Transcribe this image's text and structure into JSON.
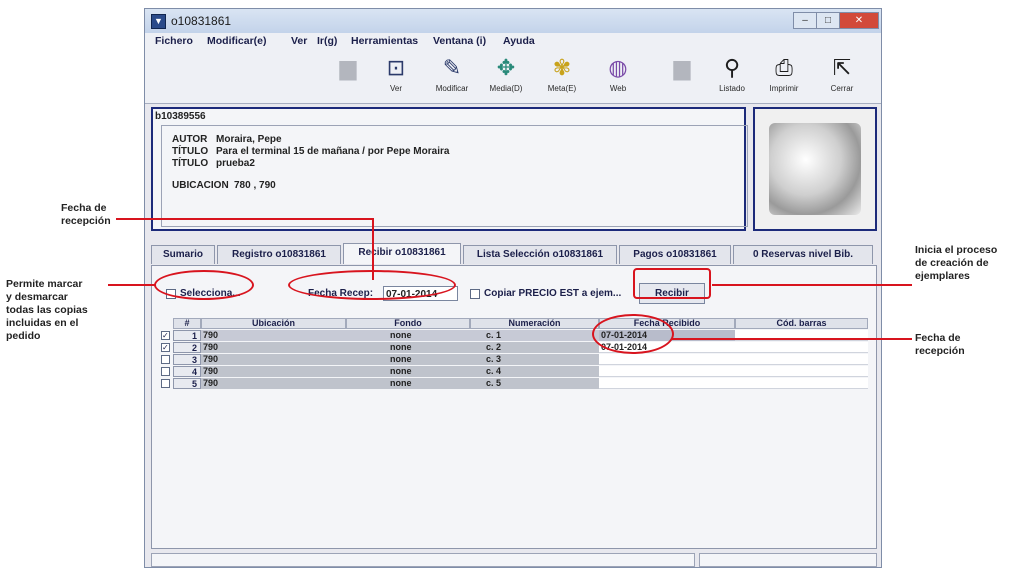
{
  "window": {
    "title": "o10831861"
  },
  "menu": [
    "Fichero",
    "Modificar(e)",
    "Ver",
    "Ir(g)",
    "Herramientas",
    "Ventana (i)",
    "Ayuda"
  ],
  "toolbar": {
    "buttons": [
      {
        "label": "",
        "icon": "disabled-icon"
      },
      {
        "label": "Ver",
        "icon": "view-icon"
      },
      {
        "label": "Modificar",
        "icon": "edit-icon"
      },
      {
        "label": "Media(D)",
        "icon": "media-icon"
      },
      {
        "label": "Meta(E)",
        "icon": "meta-icon"
      },
      {
        "label": "Web",
        "icon": "web-icon"
      },
      {
        "label": "",
        "icon": "disabled-icon"
      },
      {
        "label": "Listado",
        "icon": "search-icon"
      },
      {
        "label": "Imprimir",
        "icon": "printer-icon"
      },
      {
        "label": "Cerrar",
        "icon": "close-icon"
      }
    ]
  },
  "bib": {
    "record_id": "b10389556",
    "autor_label": "AUTOR",
    "autor": "Moraira, Pepe",
    "titulo_label": "TÍTULO",
    "titulo": "Para el terminal 15 de mañana / por Pepe Moraira",
    "titulo2_label": "TÍTULO",
    "titulo2": "prueba2",
    "ubicacion_label": "UBICACION",
    "ubicacion": "780 , 790"
  },
  "tabs": [
    "Sumario",
    "Registro o10831861",
    "Recibir o10831861",
    "Lista Selección o10831861",
    "Pagos o10831861",
    "0 Reservas nivel Bib."
  ],
  "active_tab": 2,
  "controls": {
    "select_all_label": "Selecciona...",
    "fecha_label": "Fecha Recep:",
    "fecha_value": "07-01-2014",
    "copiar_label": "Copiar PRECIO EST a ejem...",
    "recibir_label": "Recibir"
  },
  "grid": {
    "headers": [
      "#",
      "Ubicación",
      "Fondo",
      "Numeración",
      "Fecha Recibido",
      "Cód. barras"
    ],
    "rows": [
      {
        "checked": true,
        "num": "1",
        "ubicacion": "790",
        "fondo": "none",
        "numeracion": "c. 1",
        "fecha": "07-01-2014",
        "barras": ""
      },
      {
        "checked": true,
        "num": "2",
        "ubicacion": "790",
        "fondo": "none",
        "numeracion": "c. 2",
        "fecha": "07-01-2014",
        "barras": ""
      },
      {
        "checked": false,
        "num": "3",
        "ubicacion": "790",
        "fondo": "none",
        "numeracion": "c. 3",
        "fecha": "",
        "barras": ""
      },
      {
        "checked": false,
        "num": "4",
        "ubicacion": "790",
        "fondo": "none",
        "numeracion": "c. 4",
        "fecha": "",
        "barras": ""
      },
      {
        "checked": false,
        "num": "5",
        "ubicacion": "790",
        "fondo": "none",
        "numeracion": "c. 5",
        "fecha": "",
        "barras": ""
      }
    ]
  },
  "annotations": {
    "fecha_recepcion_top": "Fecha de\nrecepción",
    "permite": "Permite marcar\ny desmarcar\ntodas las copias\nincluidas en el\npedido",
    "inicia": "Inicia el proceso\nde creación de\nejemplares",
    "fecha_recepcion_right": "Fecha de\nrecepción"
  },
  "colors": {
    "annotation_red": "#d8141e",
    "frame_blue": "#1c2a7a"
  }
}
